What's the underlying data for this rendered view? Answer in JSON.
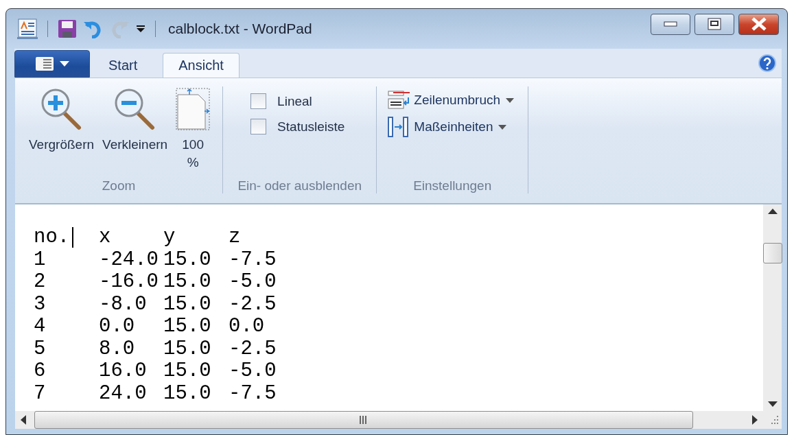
{
  "window": {
    "title": "calblock.txt - WordPad"
  },
  "quick_access": [
    {
      "kind": "save",
      "disabled": false
    },
    {
      "kind": "undo",
      "disabled": false
    },
    {
      "kind": "redo",
      "disabled": true
    }
  ],
  "tabs": [
    {
      "label": "Start",
      "selected": false
    },
    {
      "label": "Ansicht",
      "selected": true
    }
  ],
  "ribbon_groups": [
    {
      "title": "Zoom",
      "kind": "zoom",
      "items": [
        {
          "kind": "zoom_in",
          "label": "Vergrößern"
        },
        {
          "kind": "zoom_out",
          "label": "Verkleinern"
        },
        {
          "kind": "page",
          "label": "100 %"
        }
      ]
    },
    {
      "title": "Ein- oder ausblenden",
      "kind": "checks",
      "items": [
        {
          "label": "Lineal",
          "checked": false
        },
        {
          "label": "Statusleiste",
          "checked": false
        }
      ]
    },
    {
      "title": "Einstellungen",
      "kind": "menus",
      "items": [
        {
          "kind": "wrap",
          "label": "Zeilenumbruch"
        },
        {
          "kind": "units",
          "label": "Maßeinheiten"
        }
      ]
    }
  ],
  "document": {
    "lines": [
      [
        "no.",
        "x",
        "y",
        "z"
      ],
      [
        "1",
        "-24.0",
        "15.0",
        "-7.5"
      ],
      [
        "2",
        "-16.0",
        "15.0",
        "-5.0"
      ],
      [
        "3",
        "-8.0",
        "15.0",
        "-2.5"
      ],
      [
        "4",
        "0.0",
        "15.0",
        "0.0"
      ],
      [
        "5",
        "8.0",
        "15.0",
        "-2.5"
      ],
      [
        "6",
        "16.0",
        "15.0",
        "-5.0"
      ],
      [
        "7",
        "24.0",
        "15.0",
        "-7.5"
      ]
    ]
  }
}
